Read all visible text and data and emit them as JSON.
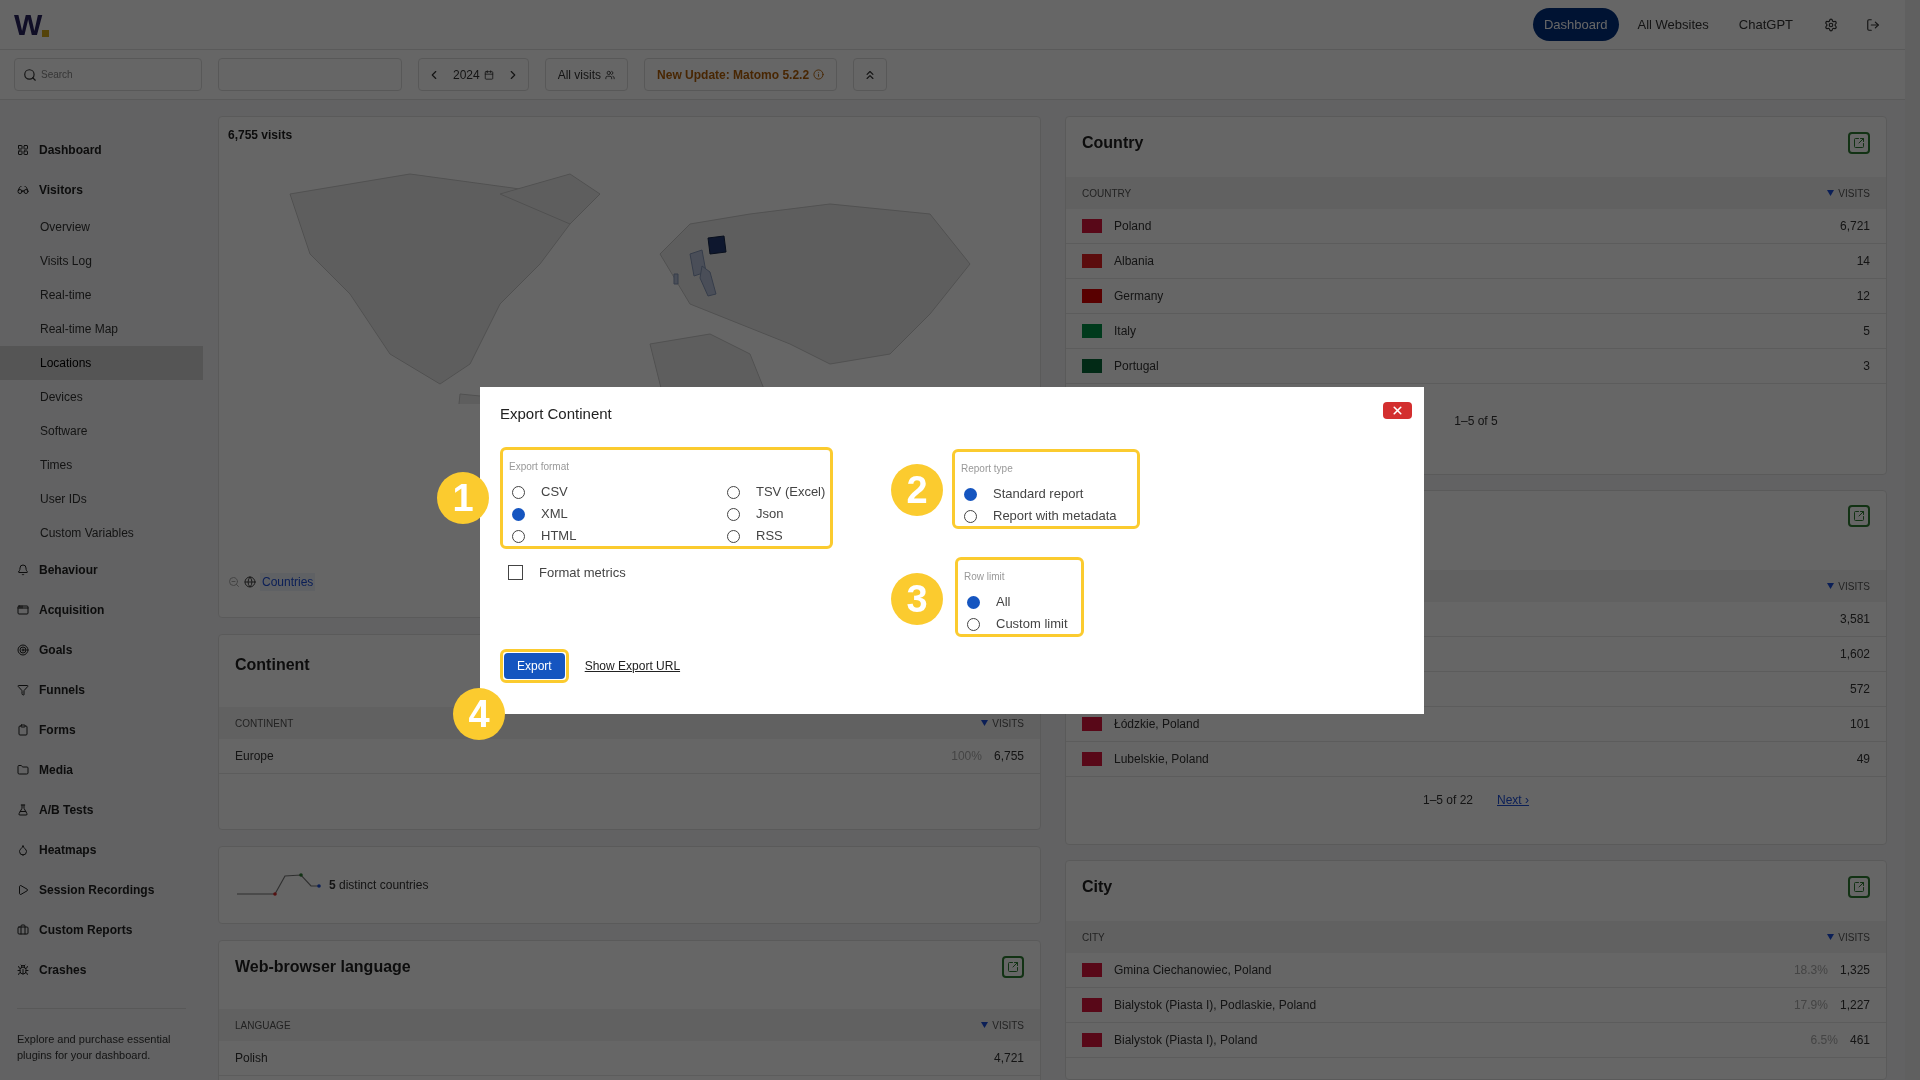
{
  "logo": "W",
  "top_nav": [
    {
      "label": "Dashboard",
      "selected": true
    },
    {
      "label": "All Websites",
      "selected": false
    },
    {
      "label": "ChatGPT",
      "selected": false
    }
  ],
  "toolbar": {
    "search_placeholder": "Search",
    "year": "2024",
    "segment": "All visits",
    "update": "New Update: Matomo 5.2.2"
  },
  "sidebar": {
    "items": [
      {
        "label": "Dashboard",
        "selected": false
      },
      {
        "label": "Visitors",
        "selected": false,
        "children": [
          {
            "label": "Overview",
            "selected": false
          },
          {
            "label": "Visits Log",
            "selected": false
          },
          {
            "label": "Real-time",
            "selected": false
          },
          {
            "label": "Real-time Map",
            "selected": false
          },
          {
            "label": "Locations",
            "selected": true
          },
          {
            "label": "Devices",
            "selected": false
          },
          {
            "label": "Software",
            "selected": false
          },
          {
            "label": "Times",
            "selected": false
          },
          {
            "label": "User IDs",
            "selected": false
          },
          {
            "label": "Custom Variables",
            "selected": false
          }
        ]
      },
      {
        "label": "Behaviour",
        "selected": false
      },
      {
        "label": "Acquisition",
        "selected": false
      },
      {
        "label": "Goals",
        "selected": false
      },
      {
        "label": "Funnels",
        "selected": false
      },
      {
        "label": "Forms",
        "selected": false
      },
      {
        "label": "Media",
        "selected": false
      },
      {
        "label": "A/B Tests",
        "selected": false
      },
      {
        "label": "Heatmaps",
        "selected": false
      },
      {
        "label": "Session Recordings",
        "selected": false
      },
      {
        "label": "Custom Reports",
        "selected": false
      },
      {
        "label": "Crashes",
        "selected": false
      }
    ],
    "footer": "Explore and purchase essential plugins for your dashboard."
  },
  "map_panel": {
    "title": "6,755 visits",
    "link": "Countries"
  },
  "continent_panel": {
    "title": "Continent",
    "columns": [
      "CONTINENT",
      "VISITS"
    ],
    "rows": [
      {
        "label": "Europe",
        "share": "100%",
        "value": "6,755"
      }
    ]
  },
  "distinct_panel": {
    "text": "**5** distinct countries"
  },
  "language_panel": {
    "title": "Web-browser language",
    "columns": [
      "LANGUAGE",
      "VISITS"
    ],
    "rows": [
      {
        "label": "Polish",
        "value": "4,721"
      }
    ]
  },
  "country_panel": {
    "title": "Country",
    "columns": [
      "COUNTRY",
      "VISITS"
    ],
    "rows": [
      {
        "label": "Poland",
        "value": "6,721",
        "color": "#580818"
      },
      {
        "label": "Albania",
        "value": "14",
        "color": "#5b0c0d"
      },
      {
        "label": "Germany",
        "value": "12",
        "color": "#580000"
      },
      {
        "label": "Italy",
        "value": "5",
        "color": "#003a1c"
      },
      {
        "label": "Portugal",
        "value": "3",
        "color": "#022a16"
      }
    ],
    "pagination": "1–5 of 5"
  },
  "region_panel": {
    "columns": [
      "VISITS"
    ],
    "rows": [
      {
        "value": "3,581"
      },
      {
        "value": "1,602"
      },
      {
        "value": "572"
      },
      {
        "label": "Łódzkie, Poland",
        "value": "101",
        "color": "#580818"
      },
      {
        "label": "Lubelskie, Poland",
        "value": "49",
        "color": "#580818"
      }
    ],
    "pagination": "1–5 of 22",
    "next": "Next ›"
  },
  "city_panel": {
    "title": "City",
    "columns": [
      "CITY",
      "VISITS"
    ],
    "rows": [
      {
        "label": "Gmina Ciechanowiec, Poland",
        "share": "18.3%",
        "value": "1,325",
        "color": "#580818"
      },
      {
        "label": "Bialystok (Piasta I), Podlaskie, Poland",
        "share": "17.9%",
        "value": "1,227",
        "color": "#580818"
      },
      {
        "label": "Bialystok (Piasta I), Poland",
        "share": "6.5%",
        "value": "461",
        "color": "#580818"
      }
    ]
  },
  "dialog": {
    "title": "Export Continent",
    "format": {
      "legend": "Export format",
      "options": [
        {
          "label": "CSV",
          "selected": false
        },
        {
          "label": "TSV (Excel)",
          "selected": false
        },
        {
          "label": "XML",
          "selected": true
        },
        {
          "label": "Json",
          "selected": false
        },
        {
          "label": "HTML",
          "selected": false
        },
        {
          "label": "RSS",
          "selected": false
        }
      ]
    },
    "format_metrics": {
      "label": "Format metrics",
      "checked": false
    },
    "report_type": {
      "legend": "Report type",
      "options": [
        {
          "label": "Standard report",
          "selected": true
        },
        {
          "label": "Report with metadata",
          "selected": false
        }
      ]
    },
    "row_limit": {
      "legend": "Row limit",
      "options": [
        {
          "label": "All",
          "selected": true
        },
        {
          "label": "Custom limit",
          "selected": false
        }
      ]
    },
    "export_button": "Export",
    "export_url_link": "Show Export URL"
  },
  "annotations": [
    "1",
    "2",
    "3",
    "4"
  ]
}
